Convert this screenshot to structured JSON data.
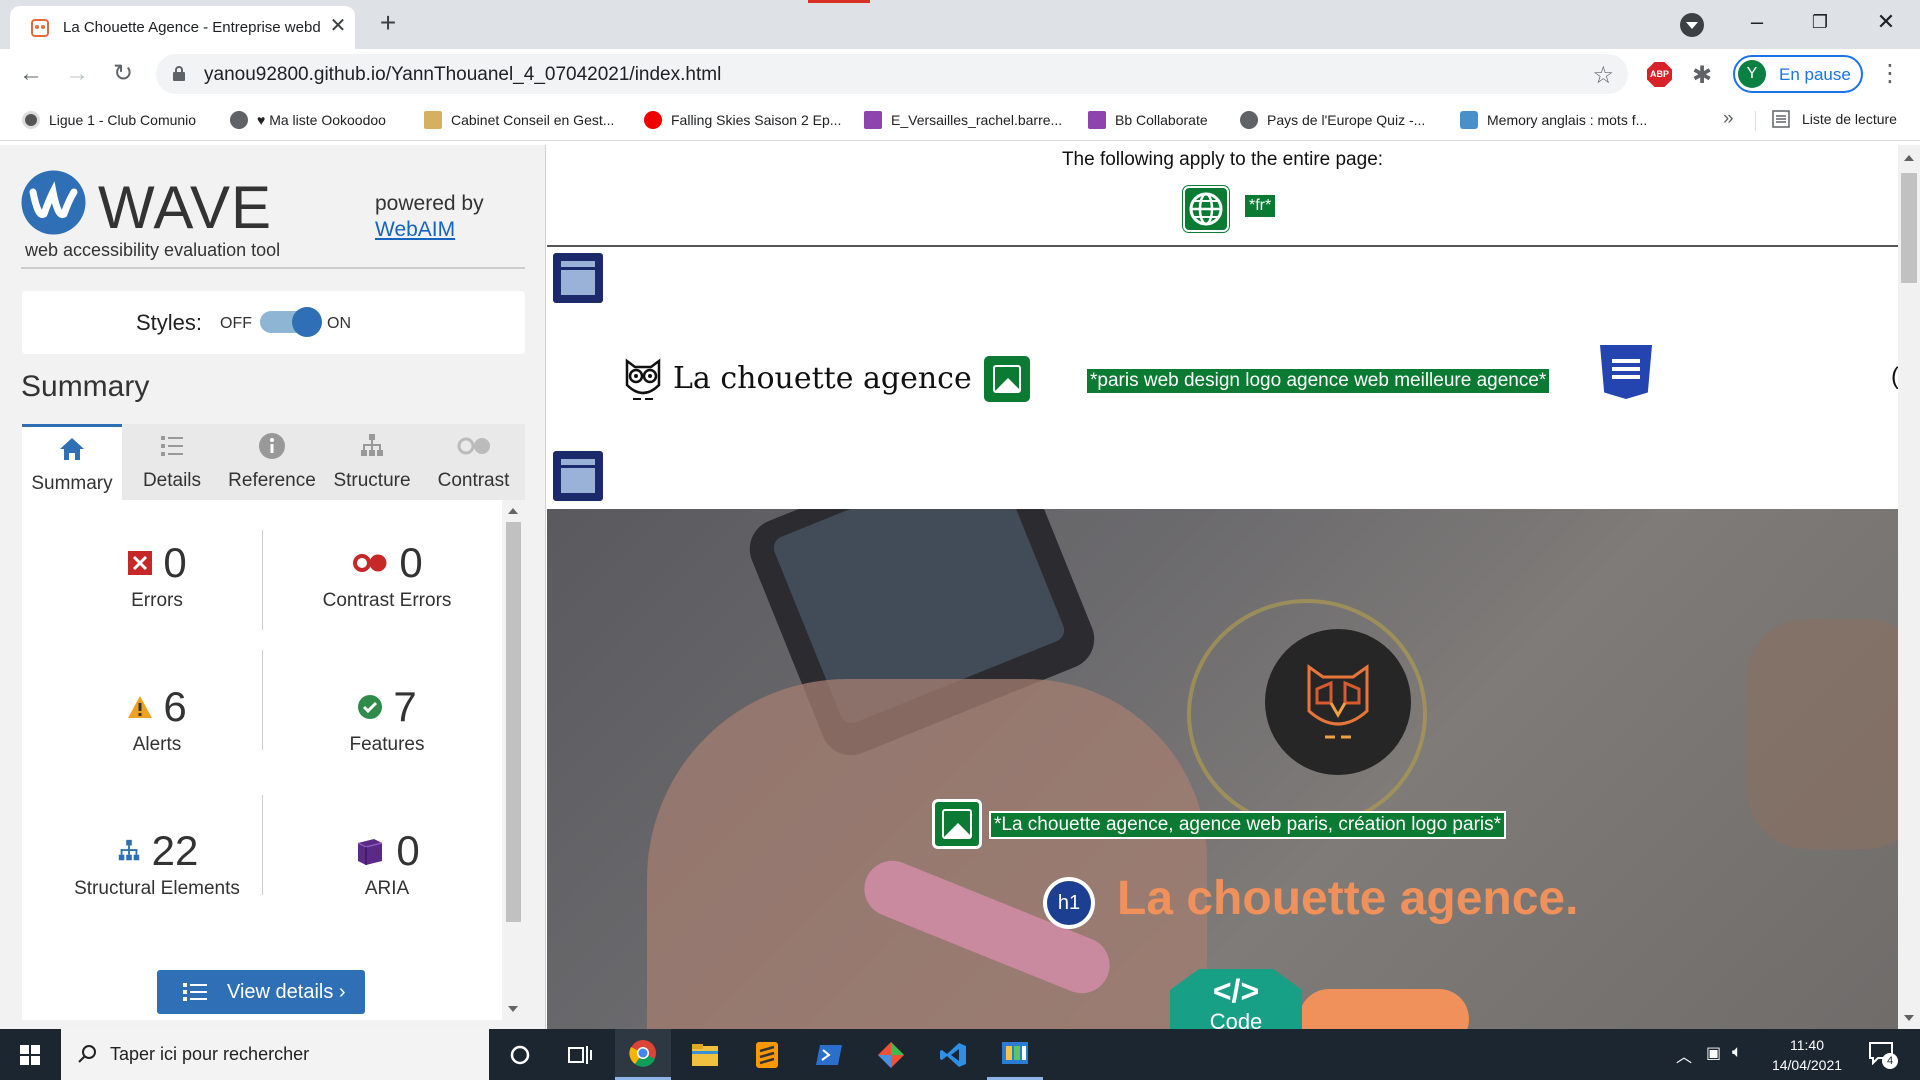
{
  "browser": {
    "tab_title": "La Chouette Agence - Entreprise webde",
    "url": "yanou92800.github.io/YannThouanel_4_07042021/index.html",
    "profile_initial": "Y",
    "profile_label": "En pause",
    "abp_label": "ABP",
    "bookmarks": [
      "Ligue 1 - Club Comunio",
      "♥ Ma liste Ookoodoo",
      "Cabinet Conseil en Gest...",
      "Falling Skies Saison 2 Ep...",
      "E_Versailles_rachel.barre...",
      "Bb Collaborate",
      "Pays de l'Europe Quiz -...",
      "Memory anglais : mots f..."
    ],
    "bookmarks_more": "»",
    "reading_list": "Liste de lecture"
  },
  "wave": {
    "name": "WAVE",
    "subtitle": "web accessibility evaluation tool",
    "powered_by": "powered by",
    "webaim": "WebAIM",
    "styles_label": "Styles:",
    "styles_off": "OFF",
    "styles_on": "ON",
    "summary_heading": "Summary",
    "tabs": [
      "Summary",
      "Details",
      "Reference",
      "Structure",
      "Contrast"
    ],
    "stats": {
      "errors": {
        "value": "0",
        "label": "Errors"
      },
      "contrast": {
        "value": "0",
        "label": "Contrast Errors"
      },
      "alerts": {
        "value": "6",
        "label": "Alerts"
      },
      "features": {
        "value": "7",
        "label": "Features"
      },
      "structural": {
        "value": "22",
        "label": "Structural Elements"
      },
      "aria": {
        "value": "0",
        "label": "ARIA"
      }
    },
    "view_details": "View details ›"
  },
  "page": {
    "note": "The following apply to the entire page:",
    "lang_alt": "*fr*",
    "logo_text": "La chouette agence",
    "logo_alt": "*paris web design logo agence web meilleure agence*",
    "hero_alt": "*La chouette agence, agence web paris, création logo paris*",
    "h1_badge": "h1",
    "hero_title": "La chouette agence.",
    "code_symbol": "</>",
    "code_label": "Code",
    "edge_char": "("
  },
  "taskbar": {
    "search_placeholder": "Taper ici pour rechercher",
    "time": "11:40",
    "date": "14/04/2021",
    "notifications": "4"
  },
  "colors": {
    "wave_blue": "#2e6fb5",
    "feature_green": "#0b7b33",
    "hero_title": "#f0905a",
    "code_teal": "#17a085"
  }
}
